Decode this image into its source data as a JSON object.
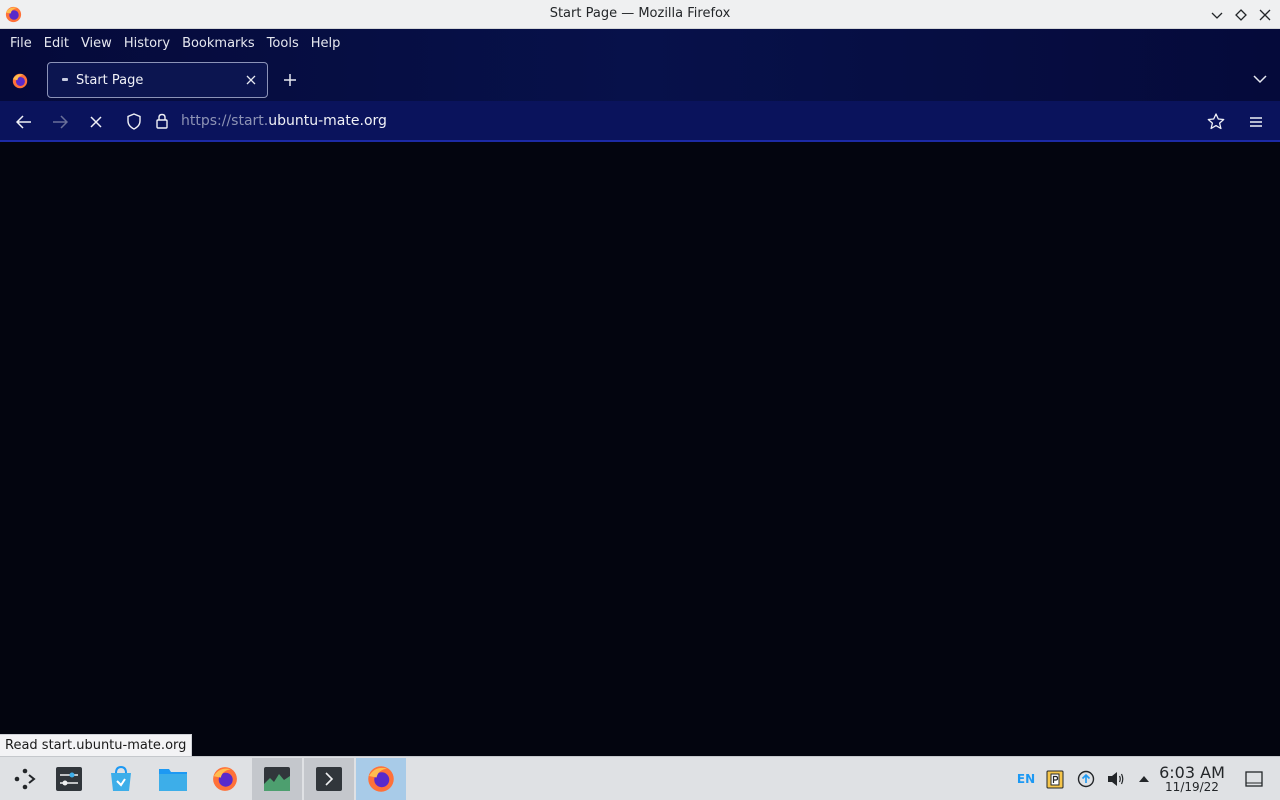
{
  "window": {
    "title": "Start Page — Mozilla Firefox",
    "app_icon": "firefox-icon",
    "controls": [
      "minimize-icon",
      "maximize-icon",
      "close-icon"
    ]
  },
  "menubar": {
    "items": [
      "File",
      "Edit",
      "View",
      "History",
      "Bookmarks",
      "Tools",
      "Help"
    ]
  },
  "tabs": [
    {
      "title": "Start Page",
      "active": true,
      "loading": true
    }
  ],
  "navbar": {
    "url_prefix": "https://start.",
    "url_host": "ubuntu-mate.org",
    "icons": [
      "back-icon",
      "forward-icon",
      "stop-icon",
      "shield-icon",
      "lock-icon",
      "star-icon",
      "hamburger-menu-icon"
    ]
  },
  "status_text": "Read start.ubuntu-mate.org",
  "taskbar": {
    "apps": [
      "application-launcher-icon",
      "system-settings-icon",
      "discover-store-icon",
      "file-manager-icon",
      "firefox-icon",
      "system-monitor-icon",
      "terminal-icon",
      "firefox-icon"
    ],
    "tray": {
      "keyboard_layout": "EN",
      "time": "6:03 AM",
      "date": "11/19/22"
    }
  },
  "colors": {
    "chrome_bg": "#07114a",
    "navbar_bg": "#0a135c",
    "content_bg": "#03050f",
    "taskbar_bg": "#dfe1e4",
    "focused_task": "#a8cbe8"
  }
}
